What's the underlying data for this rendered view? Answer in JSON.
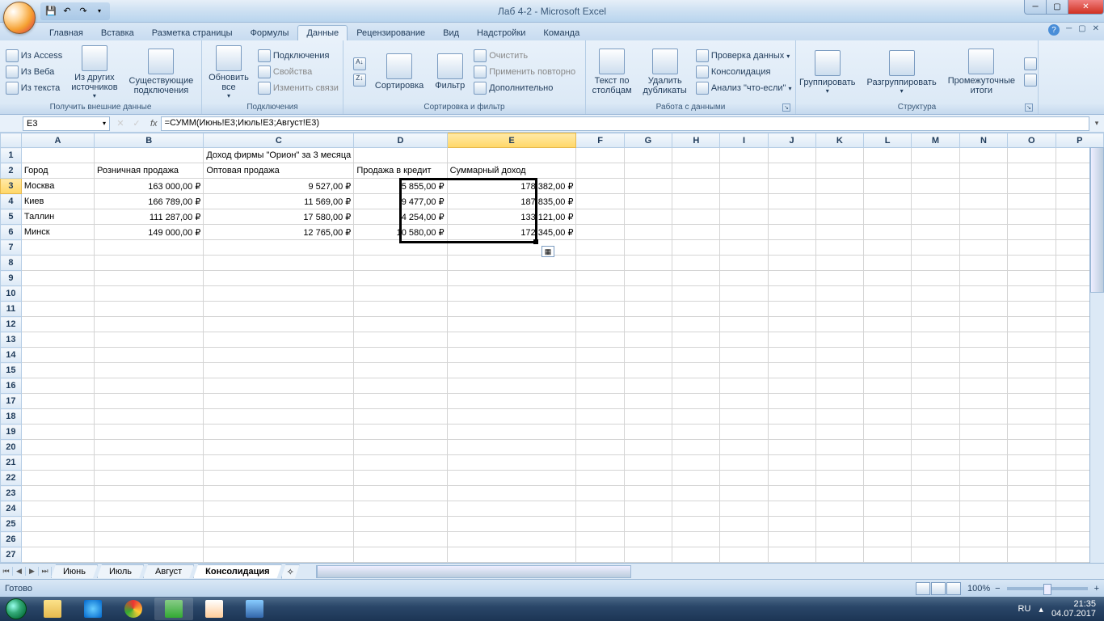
{
  "title": "Лаб 4-2 - Microsoft Excel",
  "tabs": {
    "home": "Главная",
    "insert": "Вставка",
    "layout": "Разметка страницы",
    "formulas": "Формулы",
    "data": "Данные",
    "review": "Рецензирование",
    "view": "Вид",
    "addins": "Надстройки",
    "team": "Команда"
  },
  "ribbon": {
    "ext": {
      "access": "Из Access",
      "web": "Из Веба",
      "text": "Из текста",
      "other": "Из других источников",
      "existing": "Существующие подключения",
      "label": "Получить внешние данные"
    },
    "conn": {
      "refresh": "Обновить все",
      "connections": "Подключения",
      "properties": "Свойства",
      "editlinks": "Изменить связи",
      "label": "Подключения"
    },
    "sort": {
      "sort": "Сортировка",
      "filter": "Фильтр",
      "clear": "Очистить",
      "reapply": "Применить повторно",
      "advanced": "Дополнительно",
      "label": "Сортировка и фильтр"
    },
    "tools": {
      "t2c": "Текст по столбцам",
      "dedup": "Удалить дубликаты",
      "validate": "Проверка данных",
      "consolidate": "Консолидация",
      "whatif": "Анализ \"что-если\"",
      "label": "Работа с данными"
    },
    "outline": {
      "group": "Группировать",
      "ungroup": "Разгруппировать",
      "subtotal": "Промежуточные итоги",
      "label": "Структура"
    }
  },
  "namebox": "E3",
  "formula": "=СУММ(Июнь!E3;Июль!E3;Август!E3)",
  "cols": [
    "A",
    "B",
    "C",
    "D",
    "E",
    "F",
    "G",
    "H",
    "I",
    "J",
    "K",
    "L",
    "M",
    "N",
    "O",
    "P"
  ],
  "row1_title": "Доход фирмы \"Орион\" за 3 месяца",
  "headers": {
    "city": "Город",
    "retail": "Розничная продажа",
    "wholesale": "Оптовая продажа",
    "credit": "Продажа в кредит",
    "total": "Суммарный доход"
  },
  "rows": [
    {
      "city": "Москва",
      "retail": "163 000,00 ₽",
      "wholesale": "9 527,00 ₽",
      "credit": "5 855,00 ₽",
      "total": "178 382,00 ₽"
    },
    {
      "city": "Киев",
      "retail": "166 789,00 ₽",
      "wholesale": "11 569,00 ₽",
      "credit": "9 477,00 ₽",
      "total": "187 835,00 ₽"
    },
    {
      "city": "Таллин",
      "retail": "111 287,00 ₽",
      "wholesale": "17 580,00 ₽",
      "credit": "4 254,00 ₽",
      "total": "133 121,00 ₽"
    },
    {
      "city": "Минск",
      "retail": "149 000,00 ₽",
      "wholesale": "12 765,00 ₽",
      "credit": "10 580,00 ₽",
      "total": "172 345,00 ₽"
    }
  ],
  "sheets": {
    "jun": "Июнь",
    "jul": "Июль",
    "aug": "Август",
    "cons": "Консолидация"
  },
  "status": "Готово",
  "zoom": "100%",
  "lang": "RU",
  "time": "21:35",
  "date": "04.07.2017",
  "colwidths": {
    "A": 98,
    "B": 140,
    "C": 112,
    "D": 118,
    "E": 170,
    "rest": 68
  }
}
